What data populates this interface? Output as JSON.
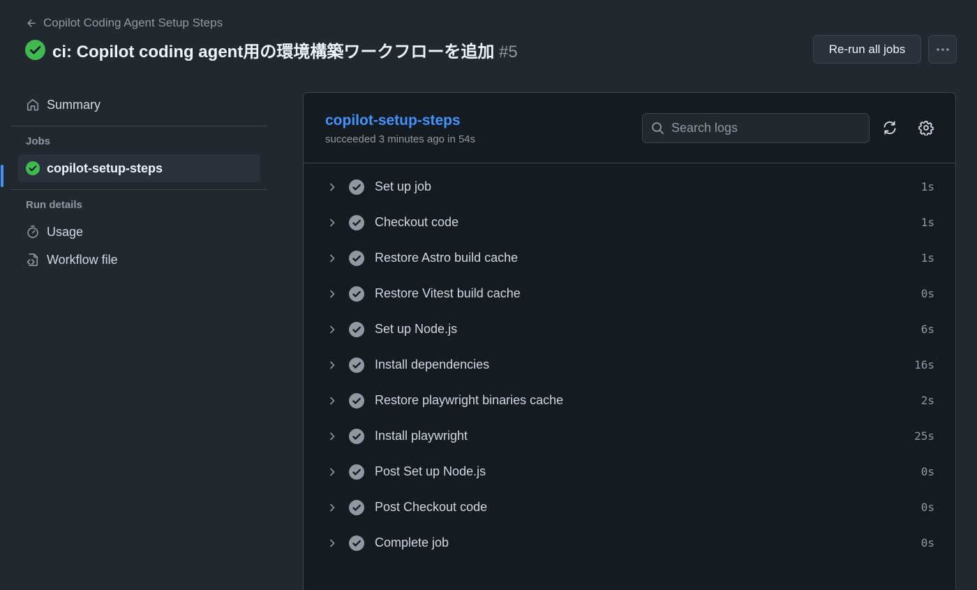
{
  "header": {
    "back_label": "Copilot Coding Agent Setup Steps",
    "title": "ci: Copilot coding agent用の環境構築ワークフローを追加",
    "run_number": "#5",
    "rerun_label": "Re-run all jobs"
  },
  "sidebar": {
    "summary_label": "Summary",
    "jobs_heading": "Jobs",
    "job_name": "copilot-setup-steps",
    "run_details_heading": "Run details",
    "usage_label": "Usage",
    "workflow_file_label": "Workflow file"
  },
  "job_panel": {
    "job_name": "copilot-setup-steps",
    "status_text": "succeeded 3 minutes ago in 54s",
    "search_placeholder": "Search logs",
    "steps": [
      {
        "name": "Set up job",
        "duration": "1s"
      },
      {
        "name": "Checkout code",
        "duration": "1s"
      },
      {
        "name": "Restore Astro build cache",
        "duration": "1s"
      },
      {
        "name": "Restore Vitest build cache",
        "duration": "0s"
      },
      {
        "name": "Set up Node.js",
        "duration": "6s"
      },
      {
        "name": "Install dependencies",
        "duration": "16s"
      },
      {
        "name": "Restore playwright binaries cache",
        "duration": "2s"
      },
      {
        "name": "Install playwright",
        "duration": "25s"
      },
      {
        "name": "Post Set up Node.js",
        "duration": "0s"
      },
      {
        "name": "Post Checkout code",
        "duration": "0s"
      },
      {
        "name": "Complete job",
        "duration": "0s"
      }
    ]
  },
  "colors": {
    "background": "#212830",
    "panel": "#151b23",
    "accent": "#4493f8",
    "success": "#3fb950",
    "muted": "#9198a1"
  },
  "icons": {
    "back": "arrow-left-icon",
    "status": "check-circle-fill-icon",
    "more": "kebab-horizontal-icon",
    "summary": "home-icon",
    "usage": "stopwatch-icon",
    "workflow_file": "file-code-icon",
    "search": "search-icon",
    "refresh": "sync-icon",
    "settings": "gear-icon",
    "expand": "chevron-right-icon"
  }
}
